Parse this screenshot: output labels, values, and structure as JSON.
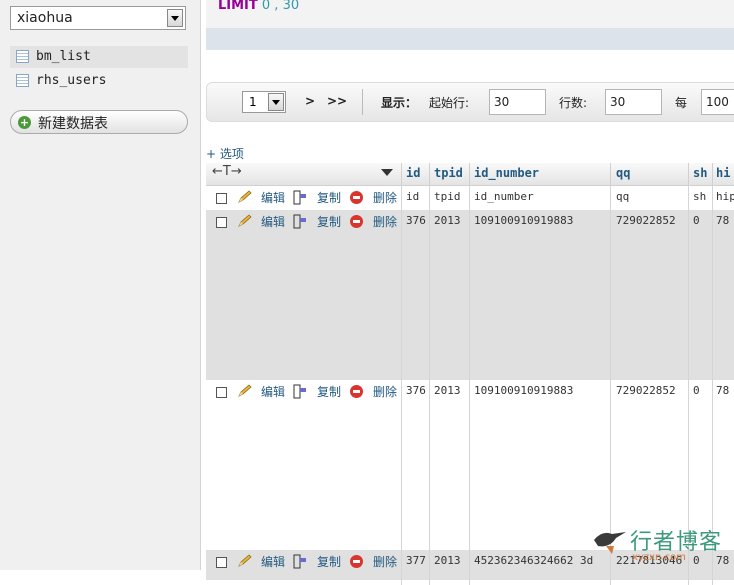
{
  "sidebar": {
    "database": "xiaohua",
    "tables": [
      {
        "name": "bm_list"
      },
      {
        "name": "rhs_users"
      }
    ],
    "new_table_label": "新建数据表"
  },
  "query": {
    "keyword": "LIMIT",
    "rest": " 0 , 30"
  },
  "navigation": {
    "page": "1",
    "next": ">",
    "last": ">>",
    "show_label": "显示：",
    "start_row_label": "起始行:",
    "start_row_value": "30",
    "rows_label": "行数:",
    "rows_value": "30",
    "per_label": "每",
    "per_value": "100"
  },
  "options_label": "+ 选项",
  "table": {
    "arrows": "←T→",
    "headers": [
      "id",
      "tpid",
      "id_number",
      "qq",
      "sh",
      "hi"
    ],
    "actions": {
      "edit": "编辑",
      "copy": "复制",
      "delete": "删除"
    },
    "rows": [
      {
        "cells": [
          "id",
          "tpid",
          "id_number",
          "qq",
          "sh",
          "hip"
        ]
      },
      {
        "cells": [
          "376",
          "2013",
          "109100910919883",
          "729022852",
          "0",
          "78"
        ]
      },
      {
        "cells": [
          "376",
          "2013",
          "109100910919883",
          "729022852",
          "0",
          "78"
        ]
      },
      {
        "cells": [
          "377",
          "2013",
          "452362346324662 3d",
          "2217813046",
          "0",
          "78"
        ]
      }
    ]
  },
  "watermark": {
    "text": "行者博客",
    "url": "xyzxn.com"
  }
}
